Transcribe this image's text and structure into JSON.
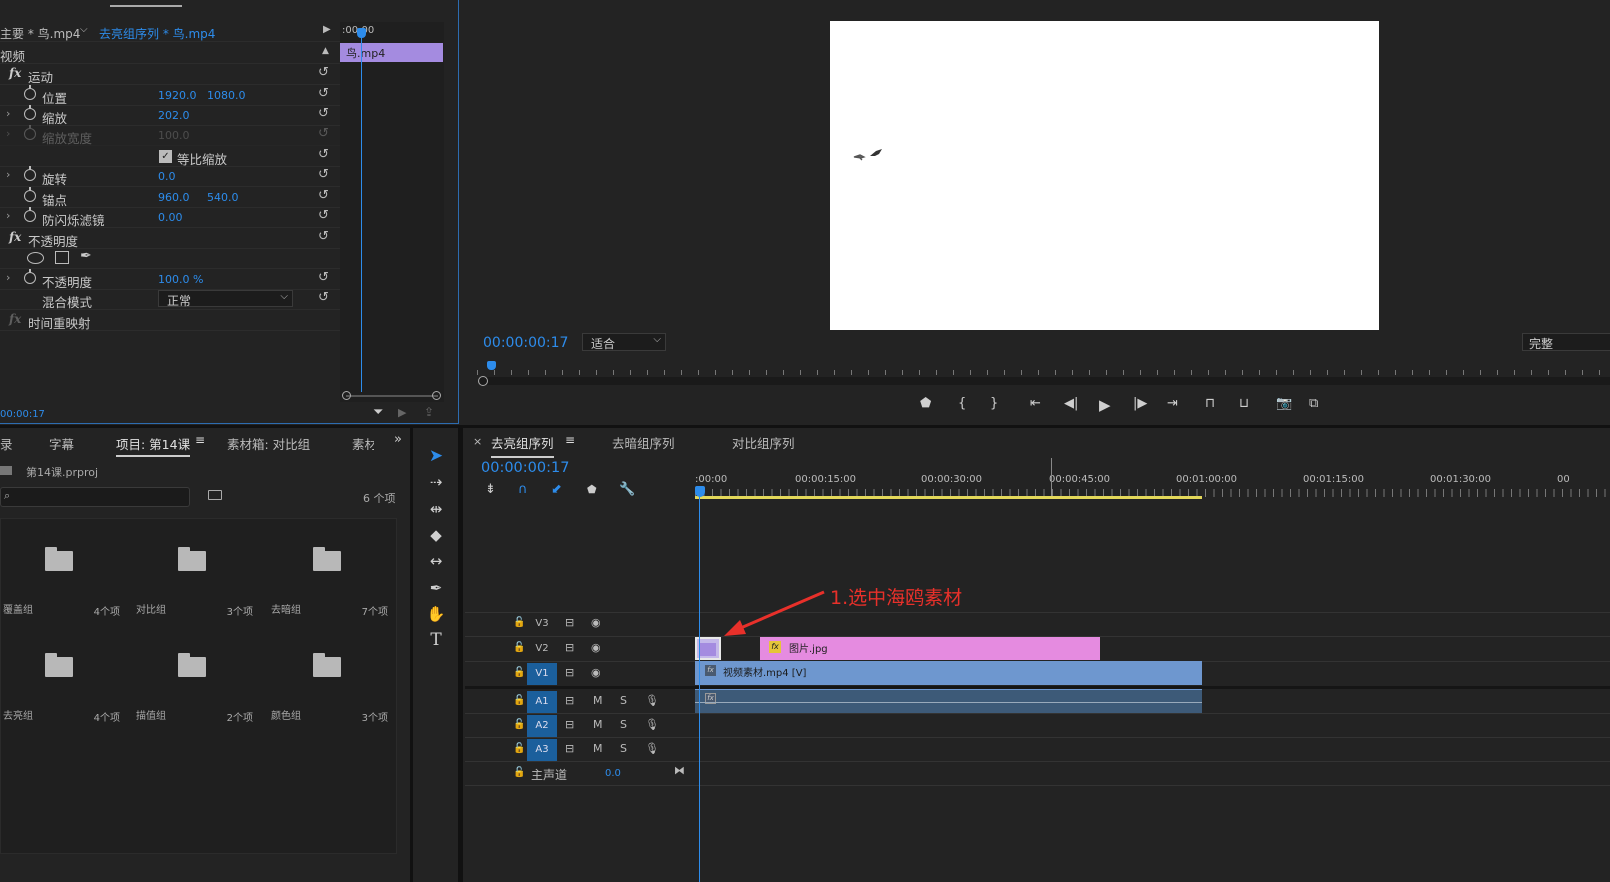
{
  "effect_controls": {
    "source_tab": "主要 * 鸟.mp4",
    "sequence_tab": "去亮组序列 * 鸟.mp4",
    "mini_timecode": ":00:00",
    "clip_name": "鸟.mp4",
    "section_video": "视频",
    "motion": "运动",
    "position": {
      "label": "位置",
      "x": "1920.0",
      "y": "1080.0"
    },
    "scale": {
      "label": "缩放",
      "value": "202.0"
    },
    "scale_width": {
      "label": "缩放宽度",
      "value": "100.0"
    },
    "uniform_scale": "等比缩放",
    "rotation": {
      "label": "旋转",
      "value": "0.0"
    },
    "anchor": {
      "label": "锚点",
      "x": "960.0",
      "y": "540.0"
    },
    "flicker": {
      "label": "防闪烁滤镜",
      "value": "0.00"
    },
    "opacity_group": "不透明度",
    "opacity": {
      "label": "不透明度",
      "value": "100.0 %"
    },
    "blend": {
      "label": "混合模式",
      "value": "正常"
    },
    "time_remap": "时间重映射",
    "footer_timecode": "00:00:17"
  },
  "program": {
    "timecode": "00:00:00:17",
    "fit": "适合",
    "quality": "完整"
  },
  "project": {
    "tabs": [
      "录",
      "字幕",
      "项目: 第14课",
      "素材箱: 对比组",
      "素材"
    ],
    "file": "第14课.prproj",
    "count": "6 个项",
    "items": [
      {
        "name": "覆盖组",
        "count": "4个项"
      },
      {
        "name": "对比组",
        "count": "3个项"
      },
      {
        "name": "去暗组",
        "count": "7个项"
      },
      {
        "name": "去亮组",
        "count": "4个项"
      },
      {
        "name": "描值组",
        "count": "2个项"
      },
      {
        "name": "颜色组",
        "count": "3个项"
      }
    ]
  },
  "timeline": {
    "tabs": [
      "去亮组序列",
      "去暗组序列",
      "对比组序列"
    ],
    "timecode": "00:00:00:17",
    "ruler": [
      ":00:00",
      "00:00:15:00",
      "00:00:30:00",
      "00:00:45:00",
      "00:01:00:00",
      "00:01:15:00",
      "00:01:30:00",
      "00"
    ],
    "tracks": {
      "v3": "V3",
      "v2": "V2",
      "v1": "V1",
      "a1": "A1",
      "a2": "A2",
      "a3": "A3",
      "master": "主声道",
      "master_value": "0.0"
    },
    "clips": {
      "image": "图片.jpg",
      "video": "视频素材.mp4 [V]"
    },
    "annotation": "1.选中海鸥素材"
  },
  "colors": {
    "accent": "#2d8ceb",
    "clip_purple": "#a48be0",
    "clip_pink": "#e58be0",
    "clip_blue": "#6e97cf",
    "annotation_red": "#e8302a"
  }
}
